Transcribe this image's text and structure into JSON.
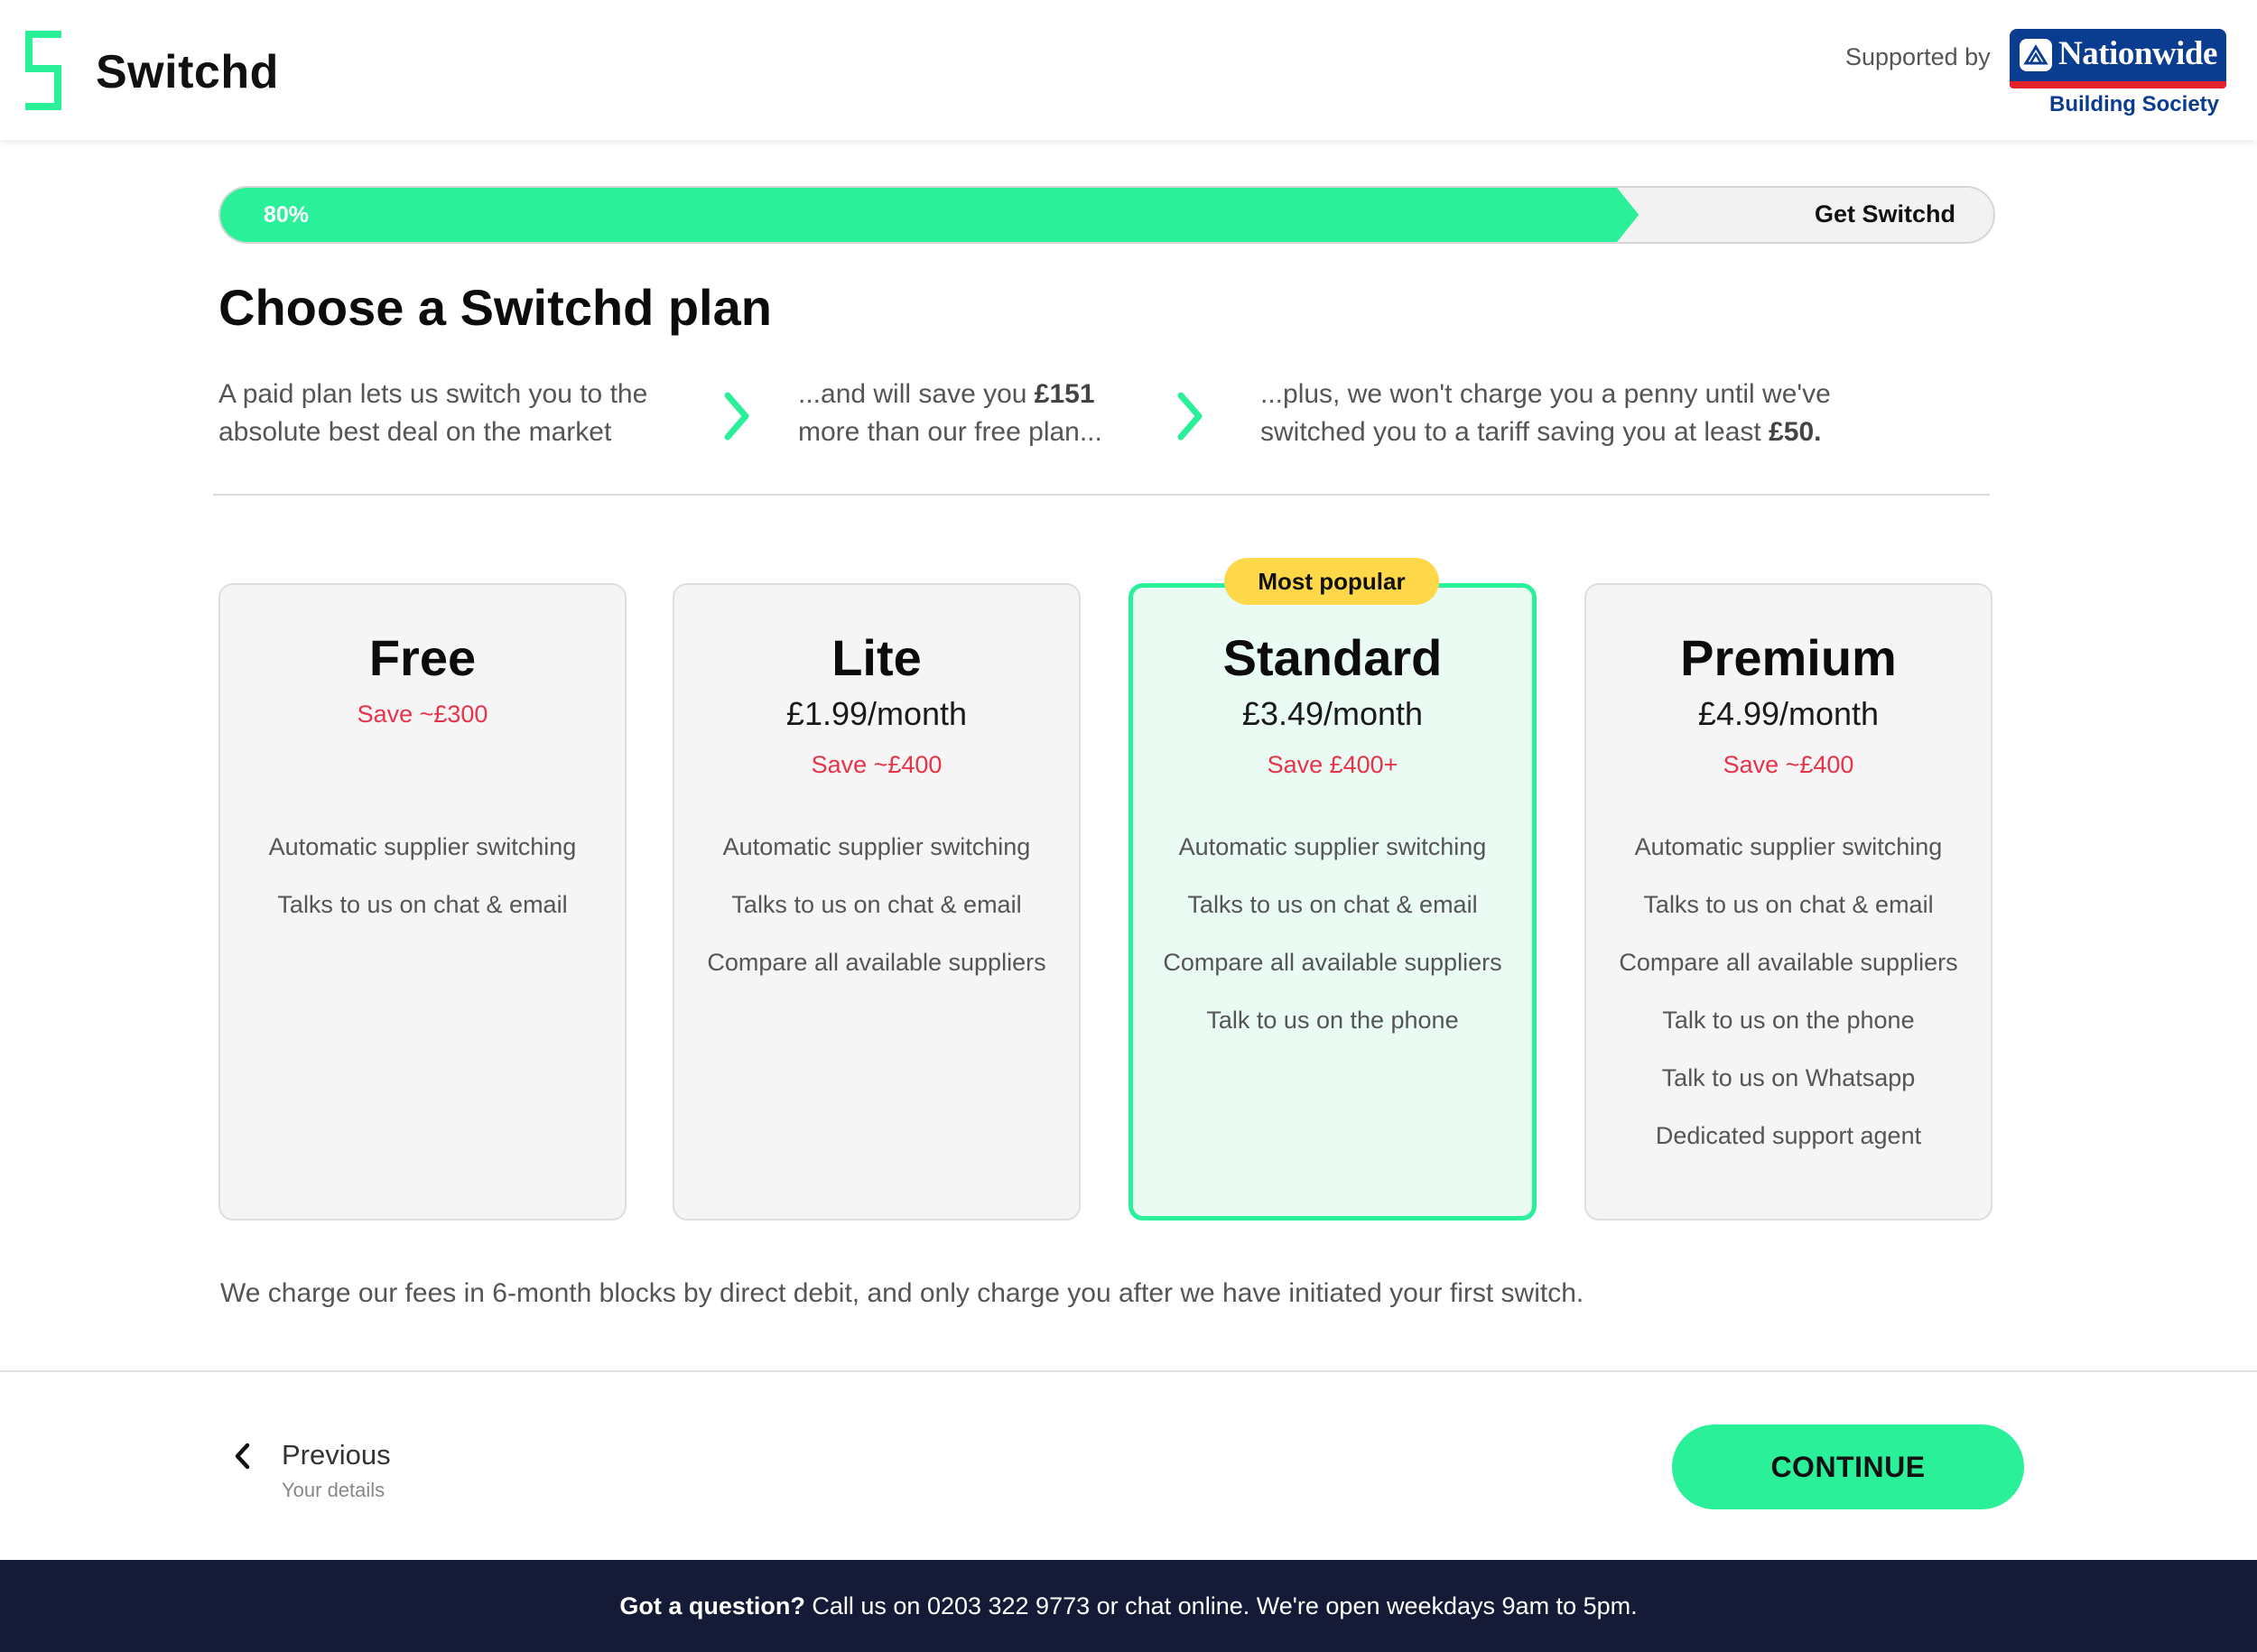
{
  "header": {
    "brand": "Switchd",
    "supported_by": "Supported by",
    "partner_name": "Nationwide",
    "partner_sub": "Building Society"
  },
  "progress": {
    "value": 0.8,
    "label": "80%",
    "end_label": "Get Switchd"
  },
  "title": "Choose a Switchd plan",
  "intro": [
    {
      "line1": "A paid plan lets us switch you to the",
      "line2": "absolute best deal on the market"
    },
    {
      "line1_pre": "...and will save you ",
      "line1_bold": "£151",
      "line2": "more than our free plan..."
    },
    {
      "line1": "...plus, we won't charge you a penny until we've",
      "line2_pre": "switched you to a tariff saving you at least ",
      "line2_bold": "£50."
    }
  ],
  "badge": "Most popular",
  "plans": [
    {
      "name": "Free",
      "price": "",
      "save": "Save ~£300",
      "features": [
        "Automatic supplier switching",
        "Talks to us on chat & email"
      ]
    },
    {
      "name": "Lite",
      "price": "£1.99/month",
      "save": "Save ~£400",
      "features": [
        "Automatic supplier switching",
        "Talks to us on chat & email",
        "Compare all available suppliers"
      ]
    },
    {
      "name": "Standard",
      "price": "£3.49/month",
      "save": "Save £400+",
      "features": [
        "Automatic supplier switching",
        "Talks to us on chat & email",
        "Compare all available suppliers",
        "Talk to us on the phone"
      ]
    },
    {
      "name": "Premium",
      "price": "£4.99/month",
      "save": "Save ~£400",
      "features": [
        "Automatic supplier switching",
        "Talks to us on chat & email",
        "Compare all available suppliers",
        "Talk to us on the phone",
        "Talk to us on Whatsapp",
        "Dedicated support agent"
      ]
    }
  ],
  "note": "We charge our fees in 6-month blocks by direct debit, and only charge you after we have initiated your first switch.",
  "nav": {
    "prev_label": "Previous",
    "prev_sub": "Your details",
    "continue_label": "CONTINUE"
  },
  "footer": {
    "bold": "Got a question?",
    "text": " Call us on 0203 322 9773 or chat online. We're open weekdays 9am to 5pm."
  },
  "colors": {
    "accent": "#2af09a",
    "save_text": "#e8334a",
    "badge": "#ffd84a",
    "footer_bg": "#151b36",
    "partner_blue": "#0a3d8f",
    "partner_red": "#e4202a"
  },
  "icons": {
    "logo": "switchd-bracket-logo",
    "step_arrow": "chevron-right-icon",
    "prev_arrow": "chevron-left-icon",
    "partner": "nationwide-logo"
  }
}
